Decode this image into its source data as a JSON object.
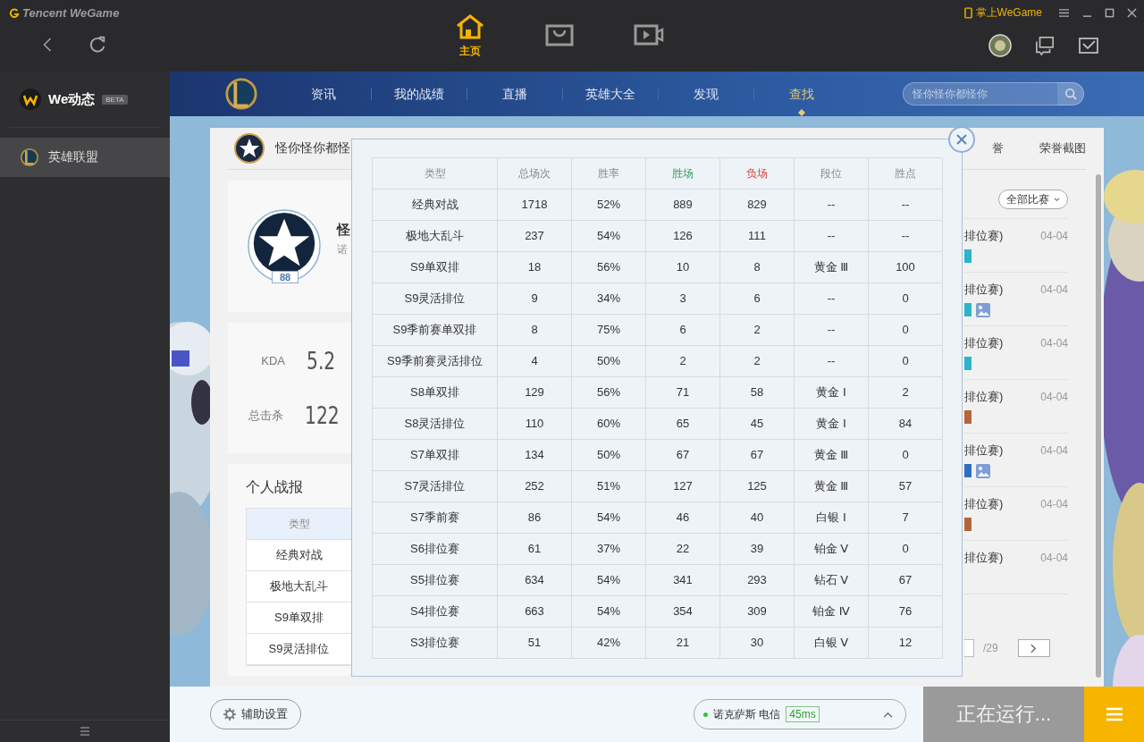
{
  "app": {
    "brand": "Tencent WeGame",
    "mobile_link": "掌上WeGame"
  },
  "top_nav": [
    {
      "kind": "home",
      "label": "主页",
      "selected": true
    },
    {
      "kind": "store",
      "selected": false
    },
    {
      "kind": "video",
      "selected": false
    }
  ],
  "sidebar": {
    "header": {
      "label": "We动态",
      "badge": "BETA"
    },
    "items": [
      {
        "label": "英雄联盟",
        "selected": true
      }
    ]
  },
  "game_nav": {
    "tabs": [
      {
        "label": "资讯",
        "selected": false
      },
      {
        "label": "我的战绩",
        "selected": false
      },
      {
        "label": "直播",
        "selected": false
      },
      {
        "label": "英雄大全",
        "selected": false
      },
      {
        "label": "发现",
        "selected": false
      },
      {
        "label": "查找",
        "selected": true
      }
    ],
    "search": {
      "placeholder": "怪你怪你都怪你"
    }
  },
  "profile": {
    "header_name": "怪你怪你都怪",
    "header_tabs": [
      "誉",
      "荣誉截图"
    ],
    "name": "怪",
    "server": "诺",
    "level": "88",
    "stats": [
      {
        "label": "KDA",
        "value": "5.2"
      },
      {
        "label": "总击杀",
        "value": "122"
      }
    ]
  },
  "report": {
    "title": "个人战报",
    "header": "类型",
    "rows": [
      "经典对战",
      "极地大乱斗",
      "S9单双排",
      "S9灵活排位"
    ]
  },
  "matches": {
    "filter": "全部比赛",
    "page_total": "/29",
    "rows": [
      {
        "mode": "排位赛)",
        "date": "04-04",
        "color": "#2fb3c9",
        "screenshot": false
      },
      {
        "mode": "排位赛)",
        "date": "04-04",
        "color": "#2fb3c9",
        "screenshot": true
      },
      {
        "mode": "排位赛)",
        "date": "04-04",
        "color": "#2fb3c9",
        "screenshot": false
      },
      {
        "mode": "排位赛)",
        "date": "04-04",
        "color": "#b5653a",
        "screenshot": false
      },
      {
        "mode": "排位赛)",
        "date": "04-04",
        "color": "#2f6fc0",
        "screenshot": true
      },
      {
        "mode": "排位赛)",
        "date": "04-04",
        "color": "#b5653a",
        "screenshot": false
      },
      {
        "mode": "排位赛)",
        "date": "04-04",
        "screenshot": false
      }
    ]
  },
  "stats_popup": {
    "columns": [
      {
        "label": "类型"
      },
      {
        "label": "总场次"
      },
      {
        "label": "胜率"
      },
      {
        "label": "胜场",
        "color": "#2e9e5b"
      },
      {
        "label": "负场",
        "color": "#d9423a"
      },
      {
        "label": "段位"
      },
      {
        "label": "胜点"
      }
    ],
    "rows": [
      [
        "经典对战",
        "1718",
        "52%",
        "889",
        "829",
        "--",
        "--"
      ],
      [
        "极地大乱斗",
        "237",
        "54%",
        "126",
        "111",
        "--",
        "--"
      ],
      [
        "S9单双排",
        "18",
        "56%",
        "10",
        "8",
        "黄金 Ⅲ",
        "100"
      ],
      [
        "S9灵活排位",
        "9",
        "34%",
        "3",
        "6",
        "--",
        "0"
      ],
      [
        "S9季前赛单双排",
        "8",
        "75%",
        "6",
        "2",
        "--",
        "0"
      ],
      [
        "S9季前赛灵活排位",
        "4",
        "50%",
        "2",
        "2",
        "--",
        "0"
      ],
      [
        "S8单双排",
        "129",
        "56%",
        "71",
        "58",
        "黄金 Ⅰ",
        "2"
      ],
      [
        "S8灵活排位",
        "110",
        "60%",
        "65",
        "45",
        "黄金 Ⅰ",
        "84"
      ],
      [
        "S7单双排",
        "134",
        "50%",
        "67",
        "67",
        "黄金 Ⅲ",
        "0"
      ],
      [
        "S7灵活排位",
        "252",
        "51%",
        "127",
        "125",
        "黄金 Ⅲ",
        "57"
      ],
      [
        "S7季前赛",
        "86",
        "54%",
        "46",
        "40",
        "白银 Ⅰ",
        "7"
      ],
      [
        "S6排位赛",
        "61",
        "37%",
        "22",
        "39",
        "铂金 Ⅴ",
        "0"
      ],
      [
        "S5排位赛",
        "634",
        "54%",
        "341",
        "293",
        "钻石 Ⅴ",
        "67"
      ],
      [
        "S4排位赛",
        "663",
        "54%",
        "354",
        "309",
        "铂金 Ⅳ",
        "76"
      ],
      [
        "S3排位赛",
        "51",
        "42%",
        "21",
        "30",
        "白银 Ⅴ",
        "12"
      ]
    ]
  },
  "bottom_bar": {
    "settings": "辅助设置",
    "server": "诺克萨斯 电信",
    "ping": "45ms",
    "online": true,
    "status": "正在运行..."
  }
}
